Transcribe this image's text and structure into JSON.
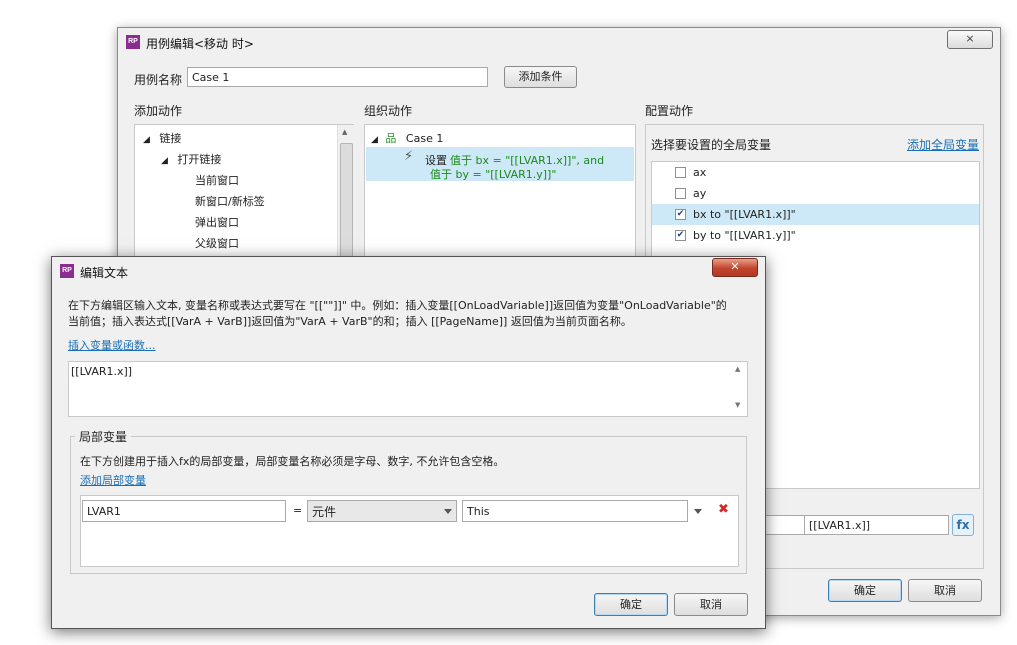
{
  "case_dialog": {
    "title": "用例编辑<移动 时>",
    "close_glyph": "⨯",
    "case_name_label": "用例名称",
    "case_name_value": "Case 1",
    "add_condition": "添加条件",
    "col_add_actions": "添加动作",
    "col_organize": "组织动作",
    "col_configure": "配置动作",
    "tree": {
      "link": "链接",
      "open_link": "打开链接",
      "items": [
        "当前窗口",
        "新窗口/新标签",
        "弹出窗口",
        "父级窗口"
      ]
    },
    "organize": {
      "case": "Case 1",
      "action_prefix": "设置 ",
      "action_line1": "值于 bx = \"[[LVAR1.x]]\", and",
      "action_line2": "值于 by = \"[[LVAR1.y]]\""
    },
    "configure": {
      "select_label": "选择要设置的全局变量",
      "add_global": "添加全局变量",
      "vars": [
        {
          "label": "ax",
          "checked": false
        },
        {
          "label": "ay",
          "checked": false
        },
        {
          "label": "bx to \"[[LVAR1.x]]\"",
          "checked": true
        },
        {
          "label": "by to \"[[LVAR1.y]]\"",
          "checked": true
        }
      ],
      "value_field": "[[LVAR1.x]]",
      "fx_label": "fx"
    },
    "ok": "确定",
    "cancel": "取消"
  },
  "edit_dialog": {
    "title": "编辑文本",
    "close_glyph": "✕",
    "instruction_line1": "在下方编辑区输入文本, 变量名称或表达式要写在 \"[[\"\"]]\" 中。例如：插入变量[[OnLoadVariable]]返回值为变量\"OnLoadVariable\"的",
    "instruction_line2": "当前值；插入表达式[[VarA + VarB]]返回值为\"VarA + VarB\"的和；插入 [[PageName]] 返回值为当前页面名称。",
    "insert_link": "插入变量或函数...",
    "text_value": "[[LVAR1.x]]",
    "local_vars_title": "局部变量",
    "local_desc": "在下方创建用于插入fx的局部变量，局部变量名称必须是字母、数字, 不允许包含空格。",
    "add_local": "添加局部变量",
    "row": {
      "name": "LVAR1",
      "eq": "=",
      "type": "元件",
      "target": "This",
      "delete_glyph": "✖"
    },
    "ok": "确定",
    "cancel": "取消"
  },
  "colors": {
    "selection": "#cde8f6",
    "link": "#1a6fb4",
    "green_text": "#1c8a1c",
    "delete_red": "#d62a2a",
    "app_icon": "#8b2c8f"
  }
}
